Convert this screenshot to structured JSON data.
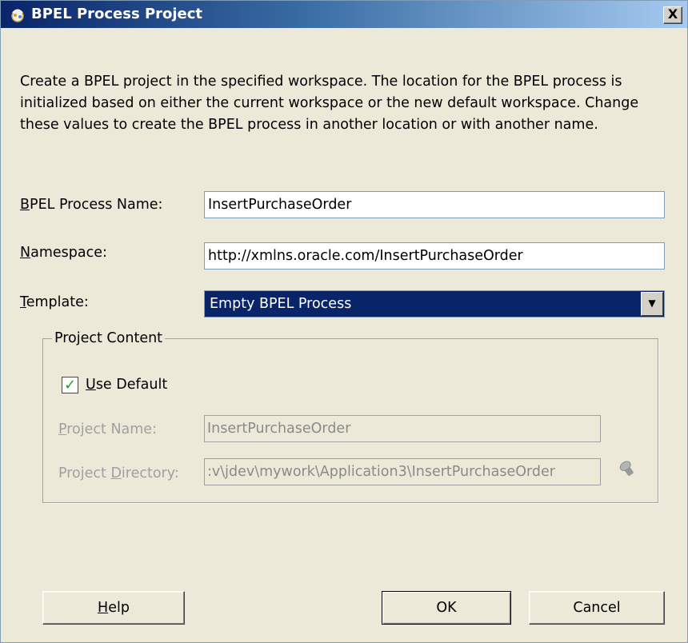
{
  "window": {
    "title": "BPEL Process Project",
    "close_label": "X"
  },
  "description": "Create a BPEL project in the specified workspace. The location for the BPEL process is initialized based on either the current workspace or the new default workspace. Change these values to create the BPEL process in another location or with another name.",
  "form": {
    "process_name": {
      "label_mnemonic": "B",
      "label_rest": "PEL Process Name:",
      "value": "InsertPurchaseOrder"
    },
    "namespace": {
      "label_mnemonic": "N",
      "label_rest": "amespace:",
      "value": "http://xmlns.oracle.com/InsertPurchaseOrder"
    },
    "template": {
      "label_mnemonic": "T",
      "label_rest": "emplate:",
      "selected": "Empty BPEL Process"
    }
  },
  "project_content": {
    "legend": "Project Content",
    "use_default": {
      "checked": true,
      "check_mark": "✓",
      "label_mnemonic": "U",
      "label_rest": "se Default"
    },
    "project_name": {
      "label_pre": "",
      "label_mnemonic": "P",
      "label_rest": "roject Name:",
      "value": "InsertPurchaseOrder"
    },
    "project_directory": {
      "label_pre": "Project ",
      "label_mnemonic": "D",
      "label_rest": "irectory:",
      "value": ":v\\jdev\\mywork\\Application3\\InsertPurchaseOrder",
      "browse_icon": "flashlight-icon"
    }
  },
  "buttons": {
    "help": {
      "mnemonic": "H",
      "rest": "elp"
    },
    "ok": "OK",
    "cancel": "Cancel"
  },
  "colors": {
    "title_gradient_start": "#0a246a",
    "title_gradient_end": "#a6caf0",
    "dialog_bg": "#ece9d8",
    "selection_bg": "#0a246a",
    "disabled_text": "#a0a0a0"
  }
}
